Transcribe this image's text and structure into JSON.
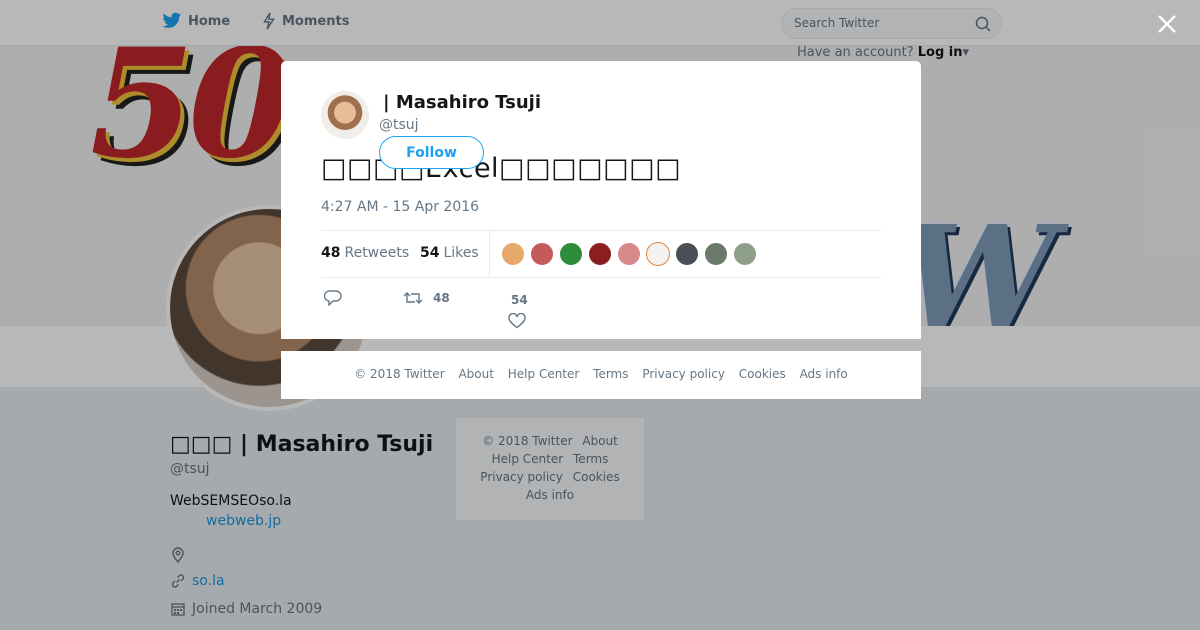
{
  "nav": {
    "home_label": "Home",
    "moments_label": "Moments"
  },
  "search": {
    "placeholder": "Search Twitter"
  },
  "account_prompt": {
    "text": "Have an account?",
    "login_label": "Log in"
  },
  "profile": {
    "name": "□□□ | Masahiro Tsuji",
    "handle": "@tsuj",
    "bio": "WebSEMSEOso.la",
    "bio_link": "webweb.jp",
    "url": "so.la",
    "joined": "Joined March 2009"
  },
  "side_footer": {
    "items": [
      "© 2018 Twitter",
      "About",
      "Help Center",
      "Terms",
      "Privacy policy",
      "Cookies",
      "Ads info"
    ]
  },
  "tweet": {
    "author_name": "| Masahiro Tsuji",
    "author_handle": "@tsuj",
    "follow_label": "Follow",
    "text": "□□□□Excel□□□□□□□",
    "timestamp": "4:27 AM - 15 Apr 2016",
    "retweets_count": "48",
    "retweets_label": "Retweets",
    "likes_count": "54",
    "likes_label": "Likes",
    "action_retweet_count": "48",
    "action_like_count": "54",
    "liker_colors": [
      "#e8a86c",
      "#c45a5a",
      "#2e8b3a",
      "#8b1e1e",
      "#d88a8a",
      "#f2f2f2",
      "#4a4f55",
      "#6a7a6a",
      "#8fa08a"
    ]
  },
  "modal_footer": {
    "items": [
      "© 2018 Twitter",
      "About",
      "Help Center",
      "Terms",
      "Privacy policy",
      "Cookies",
      "Ads info"
    ]
  },
  "colors": {
    "accent": "#1da1f2",
    "link": "#1b95e0",
    "text_primary": "#14171a",
    "text_secondary": "#657786"
  }
}
